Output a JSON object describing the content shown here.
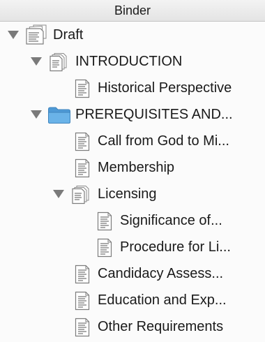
{
  "header": {
    "title": "Binder"
  },
  "tree": {
    "draft": "Draft",
    "introduction": "INTRODUCTION",
    "historical": "Historical Perspective",
    "prerequisites": "PREREQUISITES AND...",
    "call": "Call from God to Mi...",
    "membership": "Membership",
    "licensing": "Licensing",
    "significance": "Significance of...",
    "procedure": "Procedure for Li...",
    "candidacy": "Candidacy Assess...",
    "education": "Education and Exp...",
    "other": "Other Requirements"
  },
  "icons": {
    "draft": "draft-stack-icon",
    "introduction": "document-stack-icon",
    "historical": "document-icon",
    "prerequisites": "folder-icon",
    "call": "document-icon",
    "membership": "document-icon",
    "licensing": "document-stack-icon",
    "significance": "document-icon",
    "procedure": "document-icon",
    "candidacy": "document-icon",
    "education": "document-icon",
    "other": "document-icon"
  },
  "colors": {
    "folder": "#6ab3e8",
    "disclosure": "#7a7a7a"
  }
}
